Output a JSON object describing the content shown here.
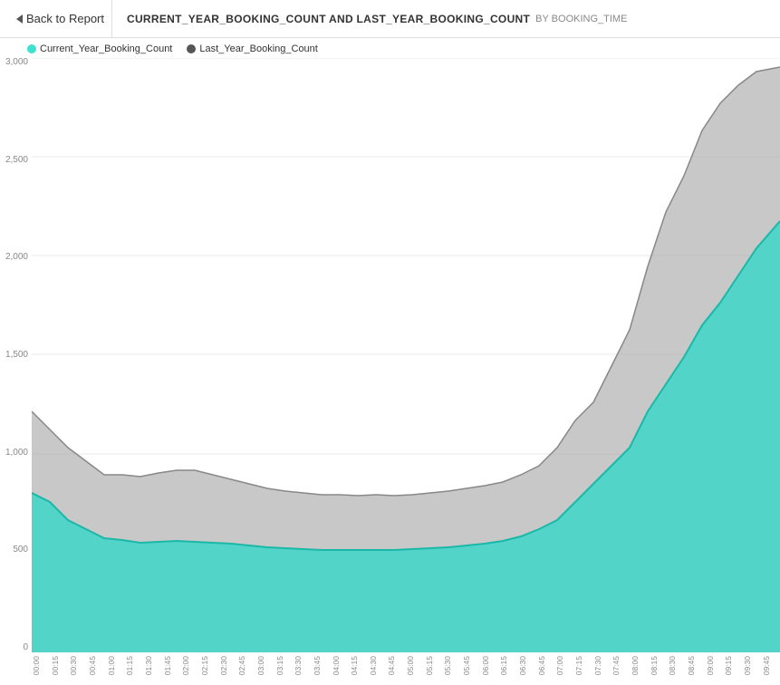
{
  "header": {
    "back_label": "Back to Report",
    "chart_title": "CURRENT_YEAR_BOOKING_COUNT AND LAST_YEAR_BOOKING_COUNT",
    "by_label": "BY BOOKING_TIME"
  },
  "legend": {
    "current_label": "Current_Year_Booking_Count",
    "last_label": "Last_Year_Booking_Count"
  },
  "y_axis": {
    "labels": [
      "000",
      "500",
      "000",
      "500",
      "000",
      "500",
      "000"
    ]
  },
  "x_axis": {
    "labels": [
      "00:00",
      "00:15",
      "00:30",
      "00:45",
      "01:00",
      "01:15",
      "01:30",
      "01:45",
      "02:00",
      "02:15",
      "02:30",
      "02:45",
      "03:00",
      "03:15",
      "03:30",
      "03:45",
      "04:00",
      "04:15",
      "04:30",
      "04:45",
      "05:00",
      "05:15",
      "05:30",
      "05:45",
      "06:00",
      "06:15",
      "06:30",
      "06:45",
      "07:00",
      "07:15",
      "07:30",
      "07:45",
      "08:00",
      "08:15",
      "08:30",
      "08:45",
      "09:00",
      "09:15",
      "09:30",
      "09:45"
    ]
  },
  "colors": {
    "cyan": "#3dd6c8",
    "gray": "#aaaaaa",
    "grid": "#e8e8e8"
  }
}
